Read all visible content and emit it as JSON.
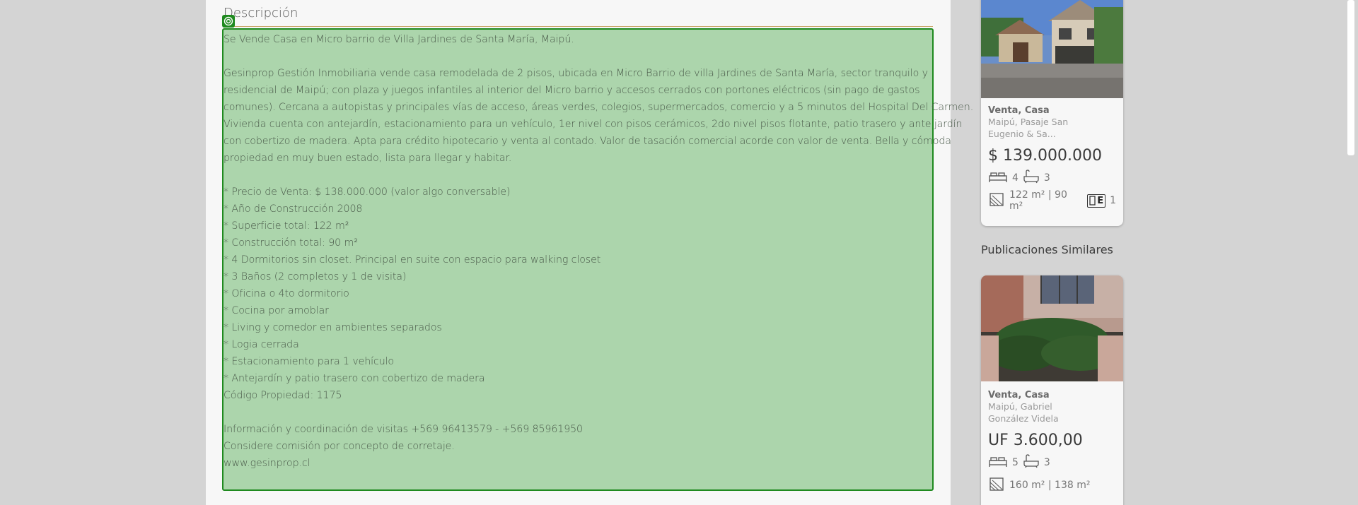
{
  "description": {
    "title": "Descripción",
    "lines": [
      "Se Vende Casa en Micro barrio de Villa Jardines de Santa María, Maipú.",
      "",
      "Gesinprop Gestión Inmobiliaria vende casa remodelada de 2 pisos, ubicada en Micro Barrio de villa Jardines de Santa María, sector tranquilo y",
      "residencial de Maipú; con plaza y juegos infantiles al interior del Micro barrio y accesos cerrados con portones eléctricos (sin pago de gastos",
      "comunes). Cercana a autopistas y principales vías de acceso, áreas verdes, colegios, supermercados, comercio y a 5 minutos del Hospital Del Carmen.",
      "Vivienda cuenta con antejardín, estacionamiento para un vehículo, 1er nivel con pisos cerámicos, 2do nivel pisos flotante, patio trasero y ante jardín",
      "con cobertizo de madera. Apta para crédito hipotecario y venta al contado. Valor de tasación comercial acorde con valor de venta. Bella y cómoda",
      "propiedad en muy buen estado, lista para llegar y habitar.",
      "",
      "* Precio de Venta: $ 138.000.000 (valor algo conversable)",
      "* Año de Construcción 2008",
      "* Superficie total: 122 m²",
      "* Construcción total: 90 m²",
      "* 4 Dormitorios sin closet. Principal en suite con espacio para walking closet",
      "* 3 Baños (2 completos y 1 de visita)",
      "* Oficina o 4to dormitorio",
      "* Cocina por amoblar",
      "* Living y comedor en ambientes separados",
      "* Logia cerrada",
      "* Estacionamiento para 1 vehículo",
      "* Antejardín y patio trasero con cobertizo de madera",
      "Código Propiedad: 1175",
      "",
      "Información y coordinación de visitas +569 96413579 - +569 85961950",
      "Considere comisión por concepto de corretaje.",
      "www.gesinprop.cl"
    ]
  },
  "current_card": {
    "type": "Venta, Casa",
    "location": "Maipú, Pasaje San Eugenio & Sa...",
    "price": "$ 139.000.000",
    "bedrooms": "4",
    "bathrooms": "3",
    "surface": "122 m² | 90 m²",
    "energy_label": "E",
    "parking": "1"
  },
  "similar": {
    "title": "Publicaciones Similares",
    "cards": [
      {
        "type": "Venta, Casa",
        "location": "Maipú, Gabriel González Videla",
        "price": "UF 3.600,00",
        "bedrooms": "5",
        "bathrooms": "3",
        "surface": "160 m² | 138 m²"
      }
    ]
  },
  "colors": {
    "highlight_fill": "#acd5ac",
    "highlight_border": "#1f8a1f",
    "page_bg": "#f7f7f7",
    "outer_bg": "#d4d4d4"
  }
}
